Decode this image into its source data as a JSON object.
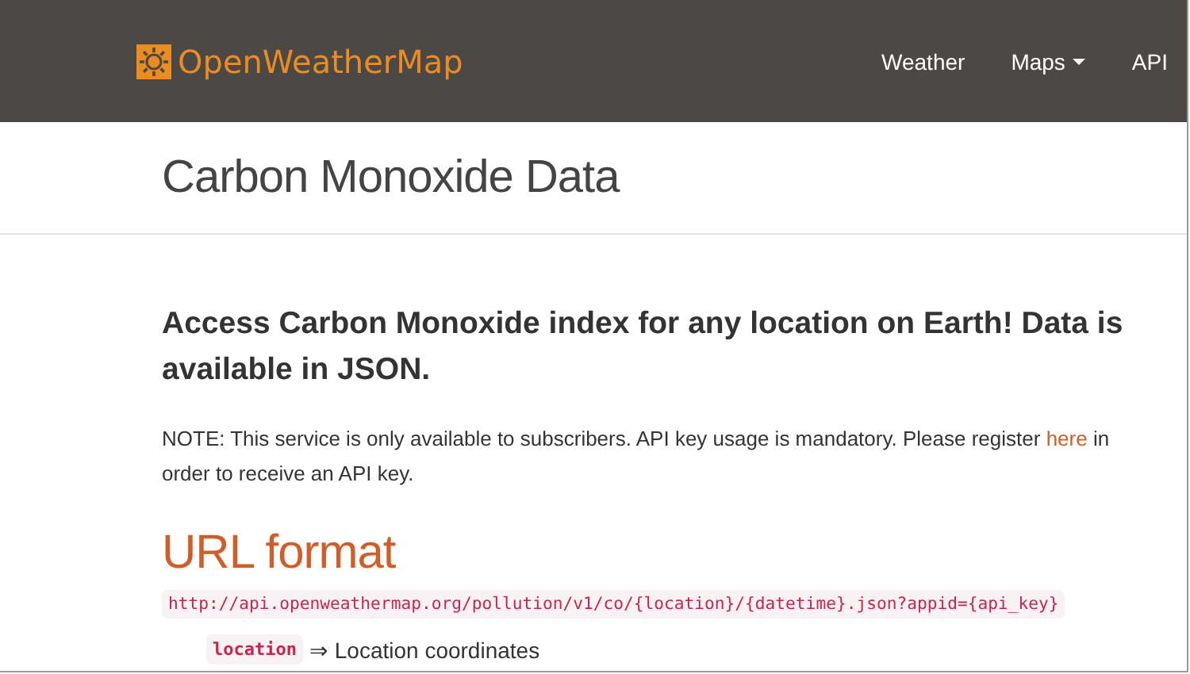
{
  "brand": {
    "name": "OpenWeatherMap"
  },
  "nav": [
    {
      "label": "Weather",
      "dropdown": false
    },
    {
      "label": "Maps",
      "dropdown": true
    },
    {
      "label": "API",
      "dropdown": false
    }
  ],
  "page_title": "Carbon Monoxide Data",
  "lead": "Access Carbon Monoxide index for any location on Earth! Data is available in JSON.",
  "note": {
    "before": "NOTE: This service is only available to subscribers. API key usage is mandatory. Please register ",
    "link": "here",
    "after": " in order to receive an API key."
  },
  "section_title": "URL format",
  "url": "http://api.openweathermap.org/pollution/v1/co/{location}/{datetime}.json?appid={api_key}",
  "params": [
    {
      "name": "location",
      "description": "⇒ Location coordinates"
    }
  ]
}
